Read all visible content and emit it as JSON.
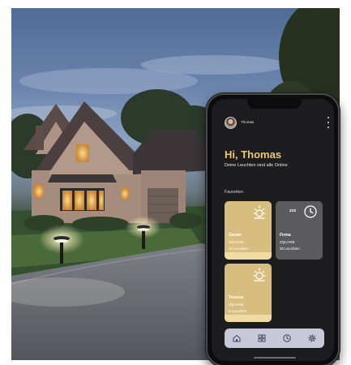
{
  "app": {
    "user_name": "Thomas",
    "greeting": "Hi, Thomas",
    "subtitle": "Deine Leuchten sind alle Online",
    "favorites_title": "Favoriten"
  },
  "tiles": [
    {
      "name": "Garten",
      "brand": "ZQUARE",
      "count": "10 Leuchten",
      "state": "on",
      "icon": "sun-icon"
    },
    {
      "name": "Firma",
      "brand": "ZQUARE",
      "count": "20 Leuchten",
      "state": "off",
      "icon": "sleep-clock-icon",
      "sleep_text": "zzz"
    },
    {
      "name": "Terasse",
      "brand": "ZQUARE",
      "count": "5 Leuchten",
      "state": "on",
      "icon": "sun-icon"
    }
  ],
  "nav": {
    "items": [
      "home-icon",
      "grid-icon",
      "clock-icon",
      "gear-icon"
    ]
  },
  "colors": {
    "accent": "#e8c97a",
    "tile_on": "#d7be80",
    "tile_off": "#5b5b5e",
    "screen_bg": "#1d1d1f",
    "navbar_bg": "#c9c8d9"
  }
}
